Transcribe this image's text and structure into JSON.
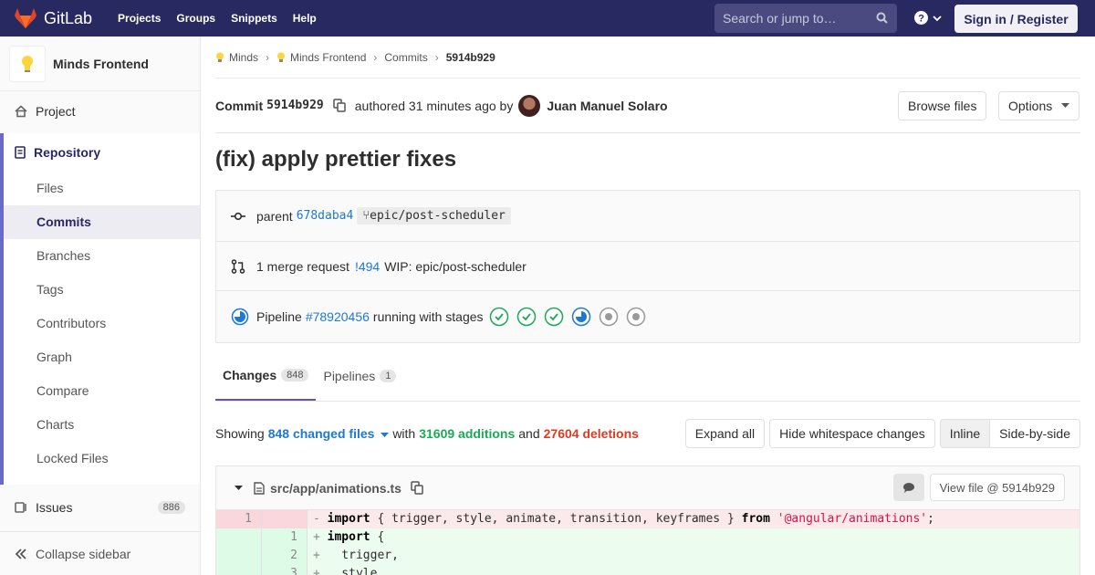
{
  "navbar": {
    "brand": "GitLab",
    "links": [
      "Projects",
      "Groups",
      "Snippets",
      "Help"
    ],
    "search_placeholder": "Search or jump to…",
    "signin": "Sign in / Register"
  },
  "sidebar": {
    "project_name": "Minds Frontend",
    "project": "Project",
    "repository": "Repository",
    "repo_items": [
      "Files",
      "Commits",
      "Branches",
      "Tags",
      "Contributors",
      "Graph",
      "Compare",
      "Charts",
      "Locked Files"
    ],
    "issues": "Issues",
    "issues_count": "886",
    "collapse": "Collapse sidebar"
  },
  "breadcrumb": {
    "group": "Minds",
    "project": "Minds Frontend",
    "section": "Commits",
    "current": "5914b929"
  },
  "commit": {
    "label": "Commit",
    "sha": "5914b929",
    "authored": "authored 31 minutes ago by",
    "author": "Juan Manuel Solaro",
    "browse": "Browse files",
    "options": "Options",
    "title": "(fix) apply prettier fixes"
  },
  "info": {
    "parent_label": "parent",
    "parent_sha": "678daba4",
    "branch": "epic/post-scheduler",
    "mr_count": "1 merge request",
    "mr_id": "!494",
    "mr_title": "WIP: epic/post-scheduler",
    "pipeline_label": "Pipeline",
    "pipeline_id": "#78920456",
    "pipeline_status": "running with stages"
  },
  "tabs": {
    "changes": "Changes",
    "changes_count": "848",
    "pipelines": "Pipelines",
    "pipelines_count": "1"
  },
  "stats": {
    "showing": "Showing",
    "files": "848 changed files",
    "with": "with",
    "additions": "31609 additions",
    "and": "and",
    "deletions": "27604 deletions",
    "expand": "Expand all",
    "whitespace": "Hide whitespace changes",
    "inline": "Inline",
    "side": "Side-by-side"
  },
  "file": {
    "path": "src/app/animations.ts",
    "view": "View file @ 5914b929",
    "lines": [
      {
        "type": "del",
        "old": "1",
        "new": "",
        "sign": "-",
        "kw1": "import",
        "mid": " { trigger, style, animate, transition, keyframes } ",
        "kw2": "from",
        "str": "'@angular/animations'",
        "end": ";"
      },
      {
        "type": "add",
        "old": "",
        "new": "1",
        "sign": "+",
        "kw1": "import",
        "mid": " {",
        "kw2": "",
        "str": "",
        "end": ""
      },
      {
        "type": "add",
        "old": "",
        "new": "2",
        "sign": "+",
        "kw1": "",
        "mid": "  trigger,",
        "kw2": "",
        "str": "",
        "end": ""
      },
      {
        "type": "add",
        "old": "",
        "new": "3",
        "sign": "+",
        "kw1": "",
        "mid": "  style,",
        "kw2": "",
        "str": "",
        "end": ""
      }
    ]
  }
}
